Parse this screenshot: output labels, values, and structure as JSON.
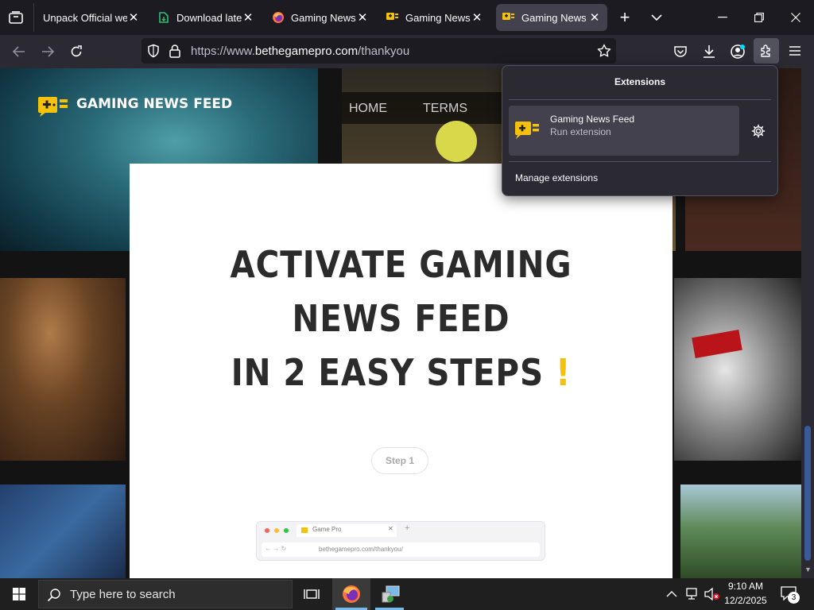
{
  "browser": {
    "tabs": [
      {
        "title": "Unpack Official website"
      },
      {
        "title": "Download latest"
      },
      {
        "title": "Gaming News Feed"
      },
      {
        "title": "Gaming News Feed"
      },
      {
        "title": "Gaming News Feed",
        "active": true
      }
    ],
    "url_prefix": "https://www.",
    "url_domain": "bethegamepro.com",
    "url_path": "/thankyou",
    "accent": "#0060df"
  },
  "site": {
    "brand": "GAMING NEWS FEED",
    "nav": {
      "home": "HOME",
      "terms": "TERMS"
    },
    "brand_color": "#f4c20d"
  },
  "modal": {
    "line1": "ACTIVATE GAMING",
    "line2": "NEWS FEED",
    "line3": "IN 2 EASY STEPS",
    "exclaim": "!",
    "step_label": "Step 1",
    "mini_tab": "Game Pro",
    "mini_url": "bethegamepro.com/thankyou/"
  },
  "extensions": {
    "title": "Extensions",
    "item_name": "Gaming News Feed",
    "item_action": "Run extension",
    "manage": "Manage extensions"
  },
  "taskbar": {
    "search_placeholder": "Type here to search",
    "time": "9:10 AM",
    "date": "12/2/2025",
    "notifications": "3"
  }
}
